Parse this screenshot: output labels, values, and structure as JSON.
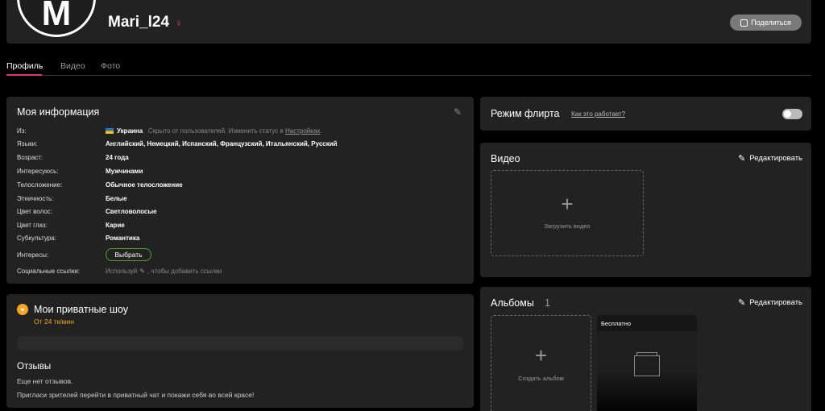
{
  "header": {
    "avatar_letter": "M",
    "username": "Mari_l24",
    "gender_symbol": "♀",
    "share_label": "Поделиться"
  },
  "tabs": [
    {
      "label": "Профиль",
      "active": true
    },
    {
      "label": "Видео",
      "active": false
    },
    {
      "label": "Фото",
      "active": false
    }
  ],
  "info": {
    "title": "Моя информация",
    "rows": {
      "from": {
        "label": "Из:",
        "country": "Украина",
        "note": "Скрыто от пользователей. Изменить статус в",
        "link": "Настройках",
        "suffix": "."
      },
      "languages": {
        "label": "Языки:",
        "value": "Английский, Немецкий, Испанский, Французский, Итальянский, Русский"
      },
      "age": {
        "label": "Возраст:",
        "value": "24 года"
      },
      "interested": {
        "label": "Интересуюсь:",
        "value": "Мужчинами"
      },
      "body": {
        "label": "Телосложение:",
        "value": "Обычное телосложение"
      },
      "ethnicity": {
        "label": "Этничность:",
        "value": "Белые"
      },
      "hair": {
        "label": "Цвет волос:",
        "value": "Светловолосые"
      },
      "eyes": {
        "label": "Цвет глаз:",
        "value": "Карие"
      },
      "subculture": {
        "label": "Субкультура:",
        "value": "Романтика"
      },
      "interests": {
        "label": "Интересы:",
        "button": "Выбрать"
      },
      "social": {
        "label": "Социальные ссылки:",
        "prefix": "Используй",
        "suffix": ", чтобы добавить ссылки"
      }
    }
  },
  "shows": {
    "title": "Мои приватные шоу",
    "price": "От 24 тк/мин",
    "reviews_title": "Отзывы",
    "reviews_empty": "Еще нет отзывов.",
    "reviews_invite": "Пригласи зрителей перейти в приватный чат и покажи себя во всей красе!"
  },
  "flirt": {
    "title": "Режим флирта",
    "link": "Как это работает?",
    "enabled": false
  },
  "video": {
    "title": "Видео",
    "edit_label": "Редактировать",
    "upload_label": "Загрузить видео"
  },
  "albums": {
    "title": "Альбомы",
    "count": "1",
    "edit_label": "Редактировать",
    "create_label": "Создать альбом",
    "items": [
      {
        "label": "Бесплатно"
      }
    ]
  },
  "colors": {
    "accent": "#e0337a",
    "price": "#f5a623",
    "interests_border": "#5a9e34"
  }
}
